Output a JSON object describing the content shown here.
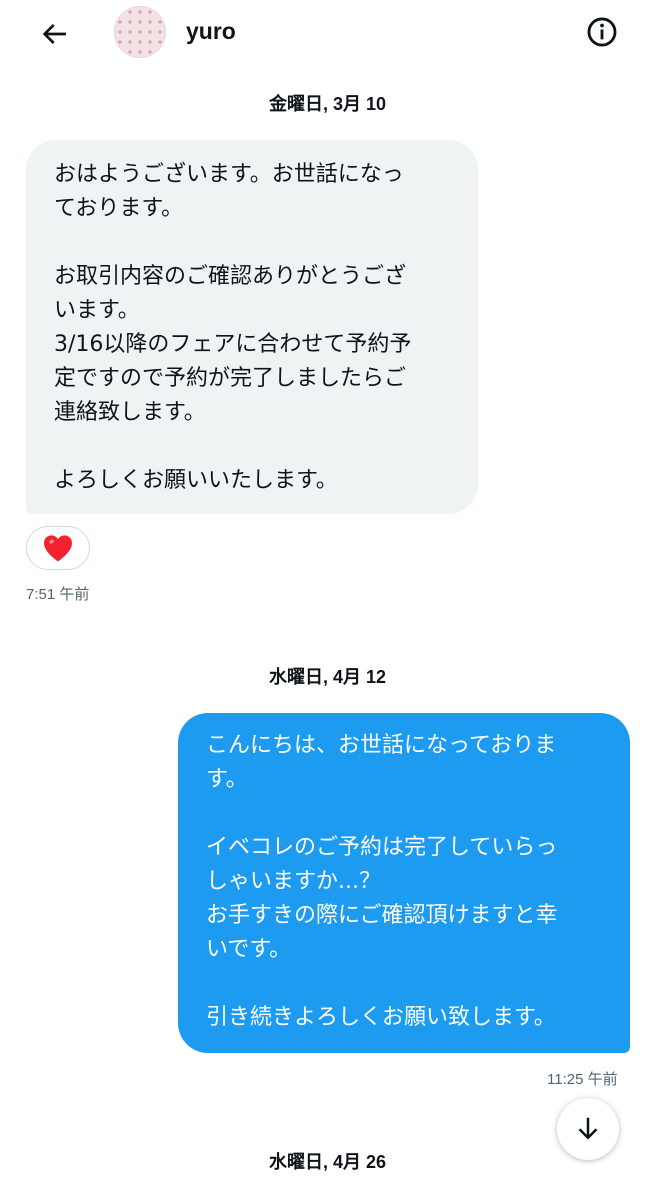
{
  "header": {
    "username": "yuro",
    "back_icon": "arrow-left-icon",
    "info_icon": "info-circle-icon"
  },
  "conversation": {
    "date_1": "金曜日, 3月 10",
    "incoming_message": {
      "lines": [
        "おはようございます。お世話になっ",
        "ております。",
        "",
        "お取引内容のご確認ありがとうござ",
        "います。",
        "3/16以降のフェアに合わせて予約予",
        "定ですので予約が完了しましたらご",
        "連絡致します。",
        "",
        "よろしくお願いいたします。"
      ],
      "reaction": "❤️",
      "time": "7:51 午前"
    },
    "date_2": "水曜日, 4月 12",
    "outgoing_message": {
      "lines": [
        "こんにちは、お世話になっておりま",
        "す。",
        "",
        "イベコレのご予約は完了していらっ",
        "しゃいますか...？",
        "お手すきの際にご確認頂けますと幸",
        "いです。",
        "",
        "引き続きよろしくお願い致します。"
      ],
      "time": "11:25 午前"
    },
    "date_3": "水曜日, 4月 26"
  },
  "colors": {
    "outgoing_bubble": "#1d9bf0",
    "incoming_bubble": "#eff3f4",
    "heart": "#f4212e"
  }
}
